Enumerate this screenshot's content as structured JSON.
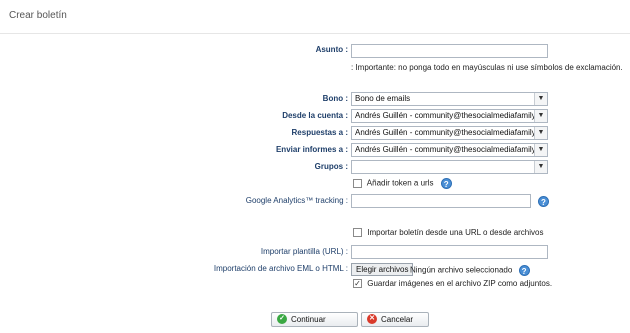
{
  "window": {
    "title": "Crear boletín"
  },
  "form": {
    "asunto": {
      "label": "Asunto :",
      "value": "",
      "hint": ": Importante: no ponga todo en mayúsculas ni use símbolos de exclamación."
    },
    "bono": {
      "label": "Bono :",
      "value": "Bono de emails"
    },
    "desde": {
      "label": "Desde la cuenta :",
      "value": "Andrés Guillén - community@thesocialmediafamily.com"
    },
    "respuestas": {
      "label": "Respuestas a :",
      "value": "Andrés Guillén - community@thesocialmediafamily.com"
    },
    "informes": {
      "label": "Enviar informes a :",
      "value": "Andrés Guillén - community@thesocialmediafamily.com"
    },
    "grupos": {
      "label": "Grupos :",
      "value": ""
    },
    "token": {
      "label": "Añadir token a urls",
      "checked": false
    },
    "analytics": {
      "label": "Google Analytics™ tracking :",
      "value": ""
    },
    "importar": {
      "label": "Importar boletín desde una URL o desde archivos",
      "checked": false
    },
    "plantilla": {
      "label": "Importar plantilla (URL) :",
      "value": ""
    },
    "eml": {
      "label": "Importación de archivo EML o HTML :",
      "button": "Elegir archivos",
      "status": "Ningún archivo seleccionado"
    },
    "zip": {
      "label": "Guardar imágenes en el archivo ZIP como adjuntos.",
      "checked": true
    }
  },
  "actions": {
    "continue_label": "Continuar",
    "cancel_label": "Cancelar"
  },
  "icons": {
    "help": "help-icon",
    "continue": "check-circle-icon",
    "cancel": "x-circle-icon",
    "dropdown": "chevron-down-icon"
  },
  "colors": {
    "label": "#1f3f6a",
    "help": "#4a8fd6",
    "continue": "#3aa843",
    "cancel": "#d93a2b"
  }
}
